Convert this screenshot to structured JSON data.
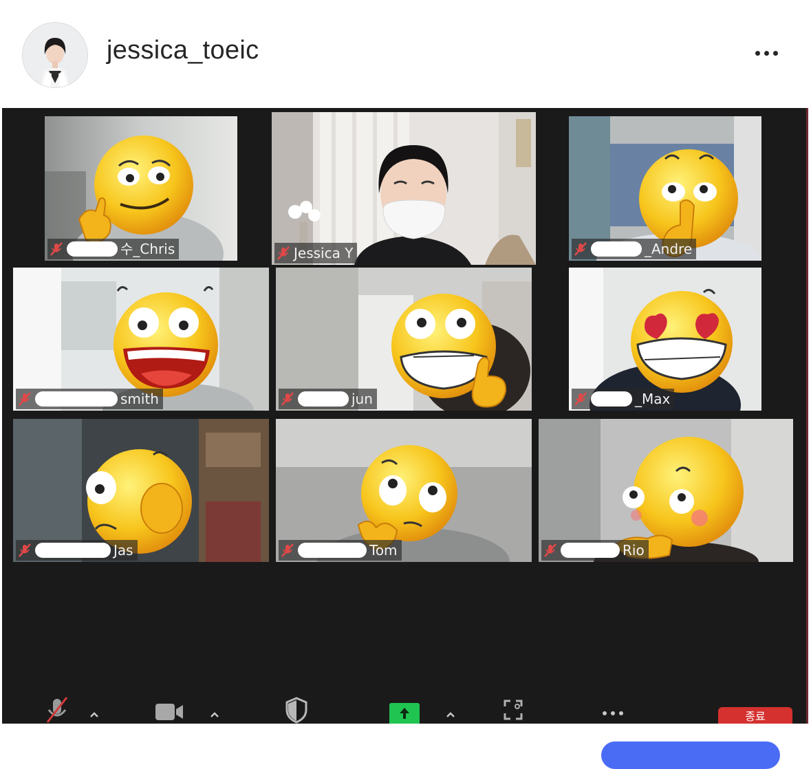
{
  "post": {
    "username": "jessica_toeic",
    "more_icon": "more-horizontal-icon"
  },
  "meeting": {
    "participants": [
      {
        "name_visible": "수_Chris",
        "emoji": "smirk-thumbs-up",
        "muted": true
      },
      {
        "name_visible": "Jessica Y",
        "emoji": null,
        "muted": true,
        "active_speaker": true
      },
      {
        "name_visible": "_Andre",
        "emoji": "shush",
        "muted": true
      },
      {
        "name_visible": "smith",
        "emoji": "laughing",
        "muted": true
      },
      {
        "name_visible": "jun",
        "emoji": "grin-thumbs-up",
        "muted": true
      },
      {
        "name_visible": "_Max",
        "emoji": "heart-eyes",
        "muted": true
      },
      {
        "name_visible": "Jas",
        "emoji": "wink-thinking",
        "muted": true
      },
      {
        "name_visible": "Tom",
        "emoji": "thinking",
        "muted": true
      },
      {
        "name_visible": "Rio",
        "emoji": "shy-blush",
        "muted": true
      }
    ],
    "toolbar": {
      "mute_icon": "microphone-muted-icon",
      "video_icon": "video-camera-icon",
      "security_icon": "shield-icon",
      "share_icon": "share-screen-arrow-icon",
      "record_icon": "focus-frame-icon",
      "more_icon": "more-horizontal-icon",
      "end_label": "종료"
    },
    "colors": {
      "active_speaker_border": "#a6d23c",
      "share_button": "#1fc451",
      "end_button": "#d4312f",
      "muted_mic": "#e04848"
    }
  }
}
